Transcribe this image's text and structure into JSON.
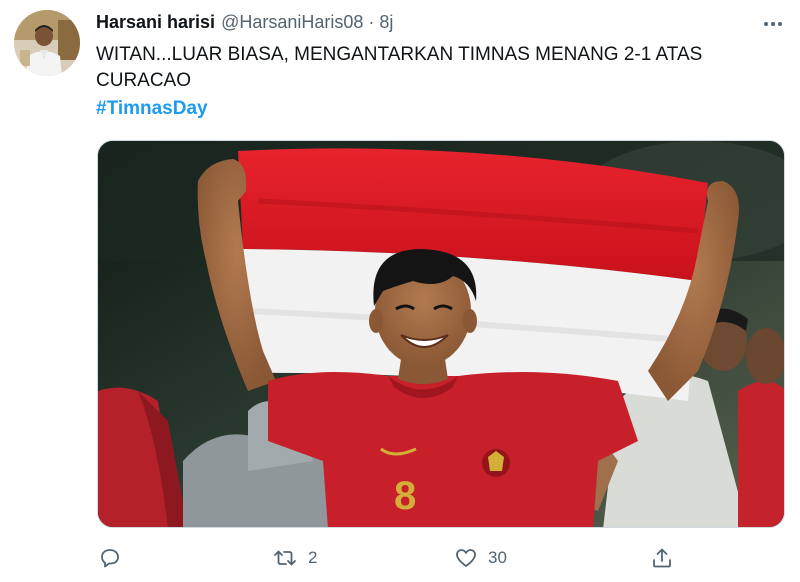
{
  "tweet": {
    "author": {
      "display_name": "Harsani harisi",
      "handle": "@HarsaniHaris08",
      "time": "8j",
      "separator": "·"
    },
    "text": "WITAN...LUAR BIASA, MENGANTARKAN TIMNAS MENANG 2-1 ATAS CURACAO",
    "hashtag": "#TimnasDay",
    "media": {
      "description_icon": "photo",
      "shirt_number": "8"
    },
    "actions": {
      "reply_icon": "reply-icon",
      "retweet_icon": "retweet-icon",
      "retweet_count": "2",
      "like_icon": "heart-icon",
      "like_count": "30",
      "share_icon": "share-icon"
    },
    "more_icon": "more-horizontal-icon"
  },
  "colors": {
    "text_primary": "#0f1419",
    "text_secondary": "#536471",
    "link": "#1d9bf0",
    "border": "#cfd9de",
    "flag_red": "#d7141f",
    "jersey_red": "#c8202a"
  }
}
